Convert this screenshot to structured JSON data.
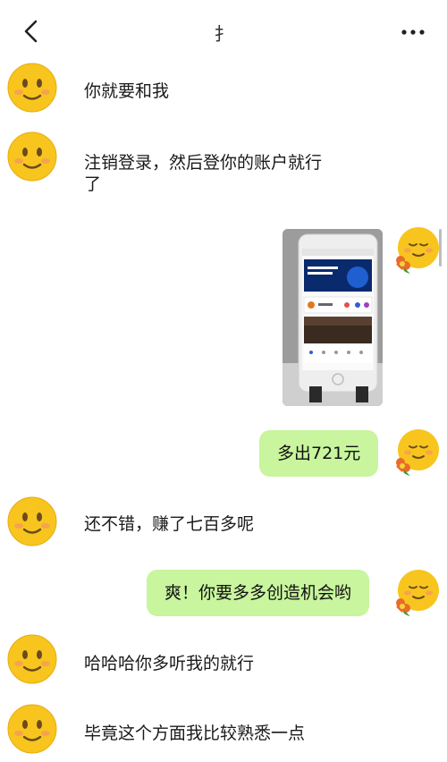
{
  "header": {
    "title": "扌",
    "back_icon": "chevron-left-icon",
    "more_icon": "more-dots-icon"
  },
  "colors": {
    "sent_bubble": "#c8f59d",
    "background": "#ffffff",
    "emoji_face": "#f7c51e",
    "emoji_blush": "#f59a5c"
  },
  "messages": [
    {
      "side": "left",
      "type": "text",
      "lines": [
        "你就要和我"
      ]
    },
    {
      "side": "left",
      "type": "text",
      "lines": [
        "注销登录，然后登你的账户就行",
        "了"
      ]
    },
    {
      "side": "right",
      "type": "image"
    },
    {
      "side": "right",
      "type": "text",
      "text": "多出721元"
    },
    {
      "side": "left",
      "type": "text",
      "lines": [
        "还不错，赚了七百多呢"
      ]
    },
    {
      "side": "right",
      "type": "text",
      "text": "爽！你要多多创造机会哟"
    },
    {
      "side": "left",
      "type": "text",
      "lines": [
        "哈哈哈你多听我的就行"
      ]
    },
    {
      "side": "left",
      "type": "text",
      "lines": [
        "毕竟这个方面我比较熟悉一点"
      ]
    }
  ]
}
